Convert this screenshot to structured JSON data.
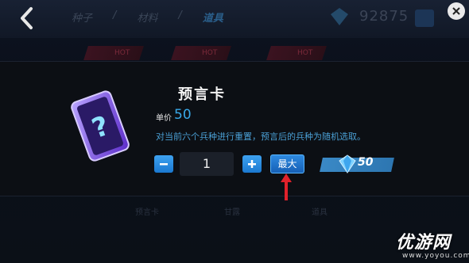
{
  "background": {
    "breadcrumb": [
      "种子",
      "材料",
      "道具"
    ],
    "gem_count": "92875",
    "tab_badges": [
      "HOT",
      "HOT",
      "HOT"
    ],
    "bottom_tabs": [
      "预言卡",
      "甘露",
      "道具"
    ]
  },
  "dialog": {
    "item_name": "预言卡",
    "price_label": "单价",
    "price_value": "50",
    "description": "对当前六个兵种进行重置，预言后的兵种为随机选取。",
    "quantity": "1",
    "max_label": "最大",
    "total_cost": "50"
  },
  "icons": {
    "back": "back-arrow-icon",
    "close": "close-icon",
    "minus": "minus-icon",
    "plus": "plus-icon",
    "gem": "diamond-gem-icon",
    "card": "prophecy-card-icon",
    "pointer": "red-arrow-icon"
  },
  "colors": {
    "accent_blue": "#39a8e8",
    "button_blue": "#1a78d0",
    "arrow_red": "#e0212b"
  },
  "watermark": {
    "main": "优游网",
    "sub": "www.yoyou.com"
  }
}
